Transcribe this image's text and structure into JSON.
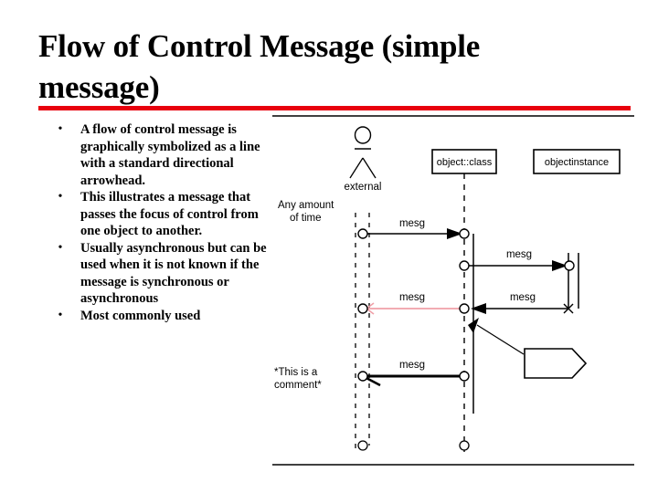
{
  "slide": {
    "title": "Flow of Control Message (simple message)",
    "rule_color": "#e8000d"
  },
  "bullets": [
    {
      "marker": "•",
      "text": "A flow of control message is graphically symbolized as a line with a standard directional arrowhead."
    },
    {
      "marker": "•",
      "text": "This illustrates a message that passes the focus of control from one object to another."
    },
    {
      "marker": "•",
      "text": "Usually asynchronous but can be used when it is not known if the message is synchronous or asynchronous"
    },
    {
      "marker": "•",
      "text": "Most commonly used"
    }
  ],
  "diagram": {
    "type": "uml-sequence-diagram",
    "actor": {
      "label": "external"
    },
    "lifelines": [
      {
        "name": "external-actor",
        "label": "external",
        "kind": "actor"
      },
      {
        "name": "object-class",
        "label": "object::class",
        "kind": "object-box"
      },
      {
        "name": "object-instance",
        "label": "objectinstance",
        "kind": "object-box"
      }
    ],
    "annotations": [
      {
        "name": "any-amount-of-time",
        "line1": "Any amount",
        "line2": "of time"
      },
      {
        "name": "comment-note",
        "line1": "*This is a",
        "line2": "comment*"
      }
    ],
    "messages": [
      {
        "id": "m1",
        "label": "mesg",
        "from": "external-actor",
        "to": "object-class",
        "direction": "right",
        "style": "solid-black"
      },
      {
        "id": "m2",
        "label": "mesg",
        "from": "object-class",
        "to": "object-instance",
        "direction": "right",
        "style": "solid-black"
      },
      {
        "id": "m3",
        "label": "mesg",
        "from": "object-class",
        "to": "external-actor",
        "direction": "left",
        "style": "highlighted-pink"
      },
      {
        "id": "m4",
        "label": "mesg",
        "from": "object-instance",
        "to": "object-class",
        "direction": "left",
        "style": "solid-black"
      },
      {
        "id": "m5",
        "label": "mesg",
        "from": "object-class",
        "to": "external-actor",
        "direction": "left",
        "style": "thick-black"
      }
    ],
    "colors": {
      "line": "#000000",
      "highlight": "#f0a0a8"
    }
  }
}
